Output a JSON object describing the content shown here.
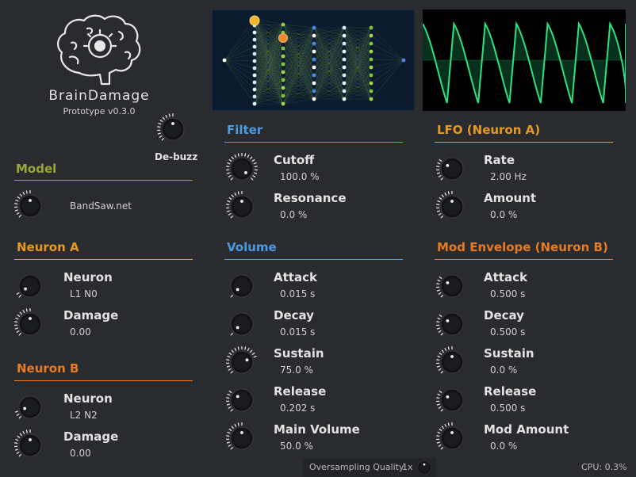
{
  "brand": {
    "name": "BrainDamage",
    "version": "Prototype v0.3.0"
  },
  "debuzz": {
    "label": "De-buzz"
  },
  "colors": {
    "model": "#9aa63a",
    "orange": "#e79a1f",
    "blue": "#4b9ae6",
    "scope": "#1fbf63"
  },
  "sections": {
    "model": {
      "title": "Model",
      "value": "BandSaw.net"
    },
    "neuron_a": {
      "title": "Neuron A",
      "params": [
        {
          "label": "Neuron",
          "value": "L1 N0",
          "fraction": 0.05
        },
        {
          "label": "Damage",
          "value": "0.00",
          "fraction": 0.5
        }
      ]
    },
    "neuron_b": {
      "title": "Neuron B",
      "params": [
        {
          "label": "Neuron",
          "value": "L2 N2",
          "fraction": 0.12
        },
        {
          "label": "Damage",
          "value": "0.00",
          "fraction": 0.5
        }
      ]
    },
    "filter": {
      "title": "Filter",
      "params": [
        {
          "label": "Cutoff",
          "value": "100.0 %",
          "fraction": 1.0
        },
        {
          "label": "Resonance",
          "value": "0.0 %",
          "fraction": 0.5
        }
      ]
    },
    "volume": {
      "title": "Volume",
      "params": [
        {
          "label": "Attack",
          "value": "0.015 s",
          "fraction": 0.02
        },
        {
          "label": "Decay",
          "value": "0.015 s",
          "fraction": 0.02
        },
        {
          "label": "Sustain",
          "value": "75.0 %",
          "fraction": 0.75
        },
        {
          "label": "Release",
          "value": "0.202 s",
          "fraction": 0.32
        },
        {
          "label": "Main Volume",
          "value": "50.0 %",
          "fraction": 0.5
        }
      ]
    },
    "lfo": {
      "title": "LFO (Neuron A)",
      "params": [
        {
          "label": "Rate",
          "value": "2.00 Hz",
          "fraction": 0.3
        },
        {
          "label": "Amount",
          "value": "0.0 %",
          "fraction": 0.5
        }
      ]
    },
    "mod_env": {
      "title": "Mod Envelope (Neuron B)",
      "params": [
        {
          "label": "Attack",
          "value": "0.500 s",
          "fraction": 0.3
        },
        {
          "label": "Decay",
          "value": "0.500 s",
          "fraction": 0.3
        },
        {
          "label": "Sustain",
          "value": "0.0 %",
          "fraction": 0.5
        },
        {
          "label": "Release",
          "value": "0.500 s",
          "fraction": 0.3
        },
        {
          "label": "Mod Amount",
          "value": "0.0 %",
          "fraction": 0.5
        }
      ]
    }
  },
  "footer": {
    "oversampling_label": "Oversampling Quality:",
    "oversampling_value": "1x",
    "cpu": "CPU: 0.3%"
  }
}
